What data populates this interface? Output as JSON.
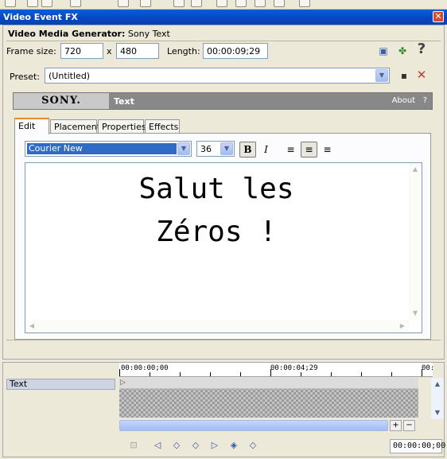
{
  "window": {
    "title": "Video Event FX",
    "close_label": "✕"
  },
  "generator": {
    "label": "Video Media Generator:",
    "name": "Sony Text"
  },
  "frame": {
    "size_label": "Frame size:",
    "width": "720",
    "x_sep": "x",
    "height": "480",
    "length_label": "Length:",
    "length": "00:00:09;29"
  },
  "preset": {
    "label": "Preset:",
    "value": "(Untitled)"
  },
  "plugin_header": {
    "logo": "SONY.",
    "title": "Text",
    "about": "About",
    "help": "?"
  },
  "tabs": [
    {
      "label": "Edit"
    },
    {
      "label": "Placement"
    },
    {
      "label": "Properties"
    },
    {
      "label": "Effects"
    }
  ],
  "text_toolbar": {
    "font": "Courier New",
    "size": "36",
    "bold": "B",
    "italic": "I"
  },
  "editor": {
    "line1": "Salut les",
    "line2": "Zéros !"
  },
  "timeline": {
    "track_name": "Text",
    "ruler_labels": [
      "00:00:00;00",
      "00:00:04;29",
      "00:"
    ],
    "timecode": "00:00:00;00",
    "zoom_in": "+",
    "zoom_out": "−"
  },
  "colors": {
    "title_bar": "#0548c1",
    "accent_tab": "#e68b2c",
    "selection": "#316ac5"
  }
}
